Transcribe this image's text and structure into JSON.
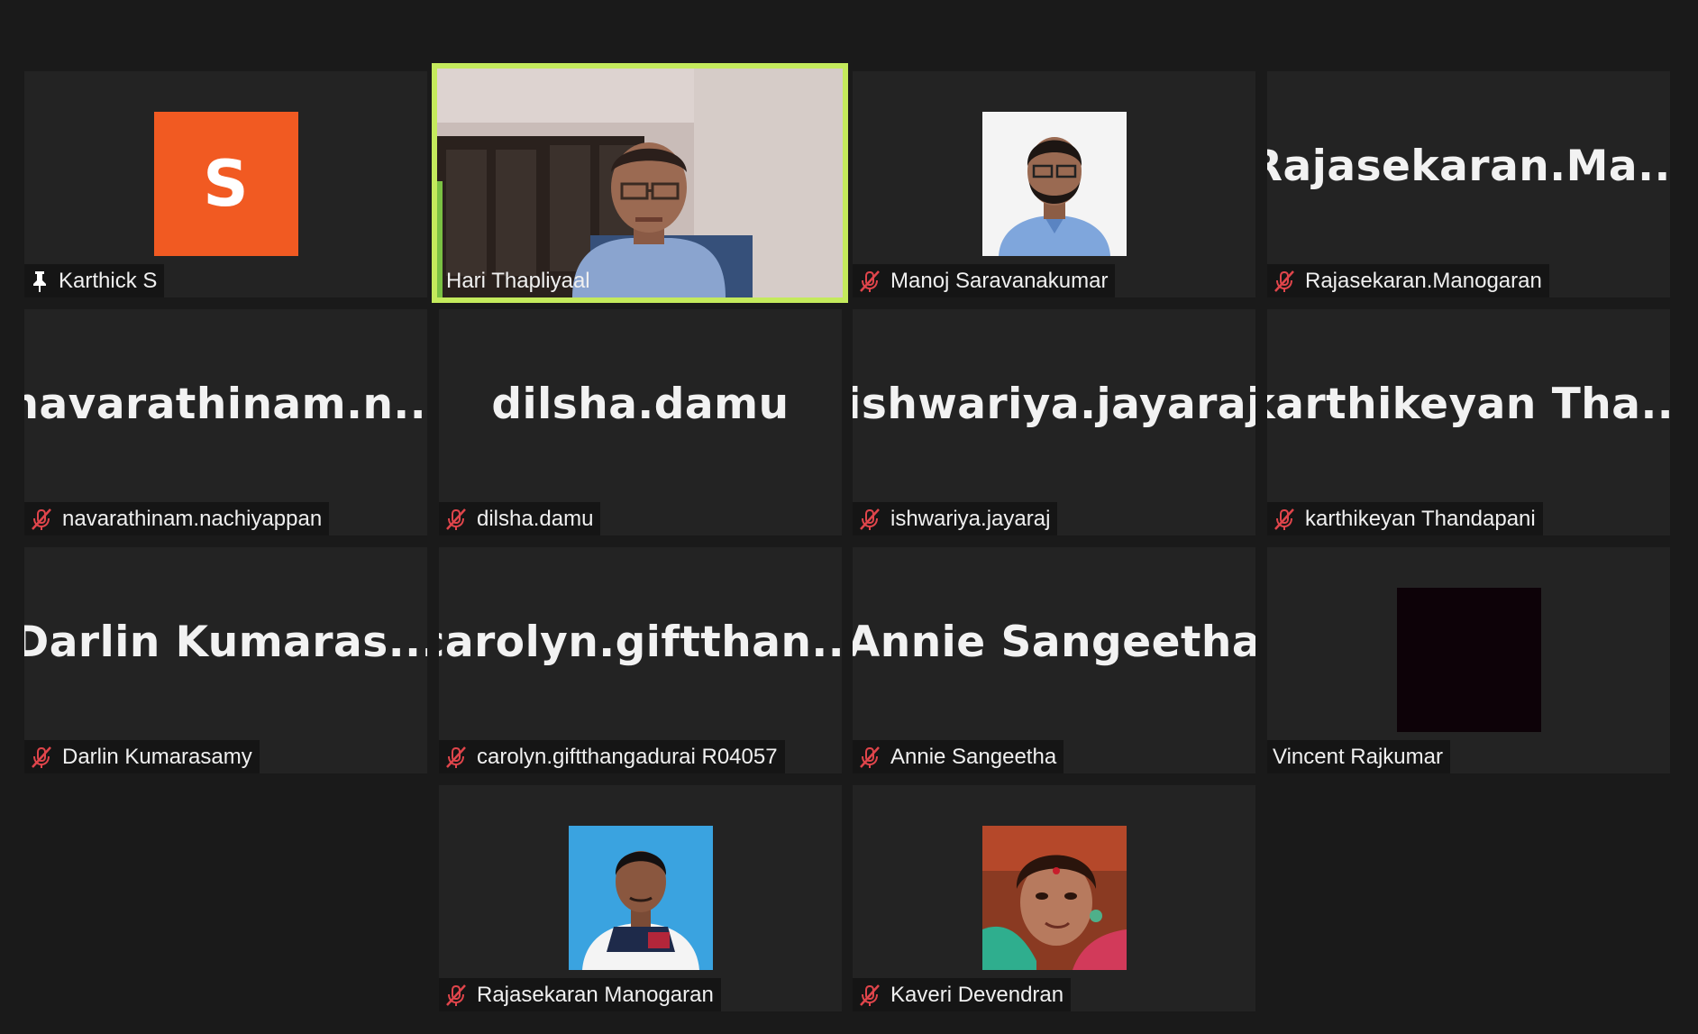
{
  "participants": [
    {
      "display_name": "Karthick S",
      "avatar_letter": "S",
      "pinned": true,
      "muted": false
    },
    {
      "display_name": "Hari Thapliyaal",
      "video_on": true,
      "active_speaker": true
    },
    {
      "display_name": "Manoj Saravanakumar",
      "has_photo": true,
      "muted": true
    },
    {
      "display_name": "Rajasekaran.Manogaran",
      "big_name": "Rajasekaran.Ma...",
      "muted": true
    },
    {
      "display_name": "navarathinam.nachiyappan",
      "big_name": "navarathinam.n...",
      "muted": true
    },
    {
      "display_name": "dilsha.damu",
      "big_name": "dilsha.damu",
      "muted": true
    },
    {
      "display_name": "ishwariya.jayaraj",
      "big_name": "ishwariya.jayaraj",
      "muted": true
    },
    {
      "display_name": "karthikeyan Thandapani",
      "big_name": "karthikeyan Tha...",
      "muted": true
    },
    {
      "display_name": "Darlin Kumarasamy",
      "big_name": "Darlin Kumaras...",
      "muted": true
    },
    {
      "display_name": "carolyn.giftthangadurai R04057",
      "big_name": "carolyn.giftthan...",
      "muted": true
    },
    {
      "display_name": "Annie Sangeetha",
      "big_name": "Annie Sangeetha",
      "muted": true
    },
    {
      "display_name": "Vincent Rajkumar",
      "has_photo": true,
      "muted": false
    },
    {
      "display_name": "Rajasekaran Manogaran",
      "has_photo": true,
      "muted": true
    },
    {
      "display_name": "Kaveri Devendran",
      "has_photo": true,
      "muted": true
    }
  ],
  "colors": {
    "background": "#1a1a1a",
    "tile": "#232323",
    "active_speaker_border": "#c4ea5c",
    "avatar_orange": "#f15a22",
    "muted_icon": "#e0454b"
  }
}
